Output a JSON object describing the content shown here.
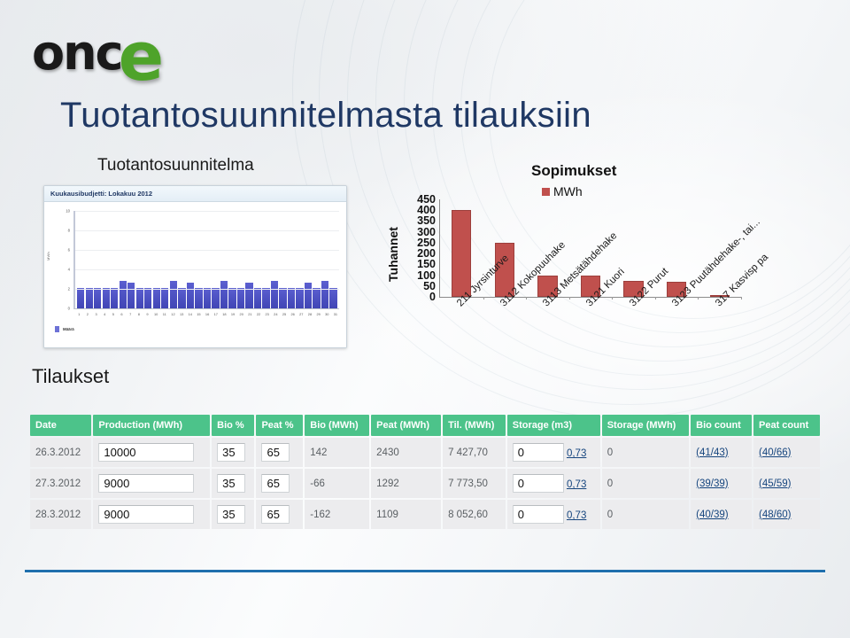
{
  "logo": {
    "text": "onc",
    "accent_letter": "e",
    "green": "#4EA32A"
  },
  "title": "Tuotantosuunnitelmasta tilauksiin",
  "headings": {
    "production_plan": "Tuotantosuunnitelma",
    "orders": "Tilaukset",
    "contracts": "Sopimukset"
  },
  "colors": {
    "title_blue": "#1F3864",
    "table_header_green": "#4CC38A",
    "contract_bar_red": "#C0504D",
    "plan_bar_blue": "#4A4FC0",
    "rule_blue": "#1F6FAD",
    "link_blue": "#16457E"
  },
  "plan_panel": {
    "panel_title": "Kuukausibudjetti: Lokakuu 2012",
    "legend_label": "Määrä"
  },
  "chart_data": [
    {
      "type": "bar",
      "id": "kuukausibudjetti",
      "title": "Kuukausibudjetti: Lokakuu 2012",
      "xlabel": "",
      "ylabel": "MWh",
      "ylim": [
        0,
        10
      ],
      "yticks": [
        0,
        2,
        4,
        6,
        8,
        10
      ],
      "grid": true,
      "legend": [
        "Määrä"
      ],
      "legend_position": "bottom-left",
      "categories": [
        "1",
        "2",
        "3",
        "4",
        "5",
        "6",
        "7",
        "8",
        "9",
        "10",
        "11",
        "12",
        "13",
        "14",
        "15",
        "16",
        "17",
        "18",
        "19",
        "20",
        "21",
        "22",
        "23",
        "24",
        "25",
        "26",
        "27",
        "28",
        "29",
        "30",
        "31"
      ],
      "values": [
        2.1,
        2.1,
        2.1,
        2.1,
        2.1,
        2.8,
        2.6,
        2.1,
        2.1,
        2.1,
        2.1,
        2.8,
        2.1,
        2.6,
        2.1,
        2.1,
        2.1,
        2.8,
        2.1,
        2.1,
        2.6,
        2.1,
        2.1,
        2.8,
        2.1,
        2.1,
        2.1,
        2.6,
        2.1,
        2.8,
        2.1
      ]
    },
    {
      "type": "bar",
      "id": "sopimukset",
      "title": "Sopimukset",
      "xlabel": "",
      "ylabel": "Tuhannet",
      "ylim": [
        0,
        450
      ],
      "yticks": [
        0,
        50,
        100,
        150,
        200,
        250,
        300,
        350,
        400,
        450
      ],
      "grid": false,
      "legend": [
        "MWh"
      ],
      "legend_position": "top",
      "categories": [
        "211 Jyrsinturve",
        "3112 Kokopuuhake",
        "3113 Metsätähdehake",
        "3121 Kuori",
        "3122 Purut",
        "3123 Puutähdehake-, tai...",
        "317 Kasvisp pa"
      ],
      "values": [
        400,
        250,
        100,
        100,
        73,
        68,
        5
      ]
    }
  ],
  "orders_table": {
    "columns": [
      "Date",
      "Production (MWh)",
      "Bio %",
      "Peat %",
      "Bio (MWh)",
      "Peat (MWh)",
      "Til. (MWh)",
      "Storage (m3)",
      "Storage (MWh)",
      "Bio count",
      "Peat count"
    ],
    "rows": [
      {
        "date": "26.3.2012",
        "production": "10000",
        "bio_pct": "35",
        "peat_pct": "65",
        "bio_mwh": "142",
        "peat_mwh": "2430",
        "til_mwh": "7 427,70",
        "storage_m3": "0",
        "storage_m3_link": "0,73",
        "storage_mwh": "0",
        "bio_count": "(41/43)",
        "peat_count": "(40/66)"
      },
      {
        "date": "27.3.2012",
        "production": "9000",
        "bio_pct": "35",
        "peat_pct": "65",
        "bio_mwh": "-66",
        "peat_mwh": "1292",
        "til_mwh": "7 773,50",
        "storage_m3": "0",
        "storage_m3_link": "0,73",
        "storage_mwh": "0",
        "bio_count": "(39/39)",
        "peat_count": "(45/59)"
      },
      {
        "date": "28.3.2012",
        "production": "9000",
        "bio_pct": "35",
        "peat_pct": "65",
        "bio_mwh": "-162",
        "peat_mwh": "1109",
        "til_mwh": "8 052,60",
        "storage_m3": "0",
        "storage_m3_link": "0,73",
        "storage_mwh": "0",
        "bio_count": "(40/39)",
        "peat_count": "(48/60)"
      }
    ]
  }
}
